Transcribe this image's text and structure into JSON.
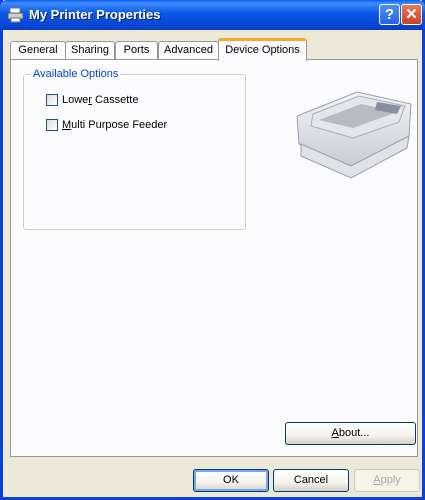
{
  "window": {
    "title": "My Printer Properties"
  },
  "title_buttons": {
    "help": "?",
    "close": "✕"
  },
  "tabs": [
    {
      "label": "General"
    },
    {
      "label": "Sharing"
    },
    {
      "label": "Ports"
    },
    {
      "label": "Advanced"
    },
    {
      "label": "Device Options",
      "active": true
    }
  ],
  "options": {
    "group_label": "Available Options",
    "items": [
      {
        "label_pre": "Lowe",
        "label_mnemonic": "r",
        "label_post": " Cassette",
        "checked": false
      },
      {
        "label_pre": "",
        "label_mnemonic": "M",
        "label_post": "ulti Purpose Feeder",
        "checked": false
      }
    ]
  },
  "buttons": {
    "about_mnemonic": "A",
    "about_rest": "bout...",
    "ok": "OK",
    "cancel": "Cancel",
    "apply_mnemonic": "A",
    "apply_rest": "pply"
  },
  "colors": {
    "titlebar": "#0b58e6",
    "tab_highlight": "#f7a928",
    "group_label": "#0046d5"
  }
}
